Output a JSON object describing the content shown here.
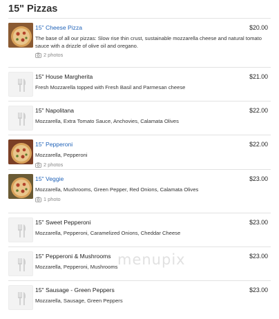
{
  "section": {
    "title": "15\" Pizzas"
  },
  "items": [
    {
      "name": "15\" Cheese Pizza",
      "link": true,
      "price": "$20.00",
      "description": "The base of all our pizzas: Slow rise thin crust, sustainable mozzarella cheese and natural tomato sauce with a drizzle of olive oil and oregano.",
      "photos": "2 photos",
      "image": "photo"
    },
    {
      "name": "15\" House Margherita",
      "link": false,
      "price": "$21.00",
      "description": "Fresh Mozzarella topped with Fresh Basil and Parmesan cheese",
      "photos": null,
      "image": "placeholder"
    },
    {
      "name": "15\" Napolitana",
      "link": false,
      "price": "$22.00",
      "description": "Mozzarella, Extra Tomato Sauce, Anchovies, Calamata Olives",
      "photos": null,
      "image": "placeholder"
    },
    {
      "name": "15\" Pepperoni",
      "link": true,
      "price": "$22.00",
      "description": "Mozzarella, Pepperoni",
      "photos": "2 photos",
      "image": "photo"
    },
    {
      "name": "15\" Veggie",
      "link": true,
      "price": "$23.00",
      "description": "Mozzarella, Mushrooms, Green Pepper, Red Onions, Calamata Olives",
      "photos": "1 photo",
      "image": "photo"
    },
    {
      "name": "15\" Sweet Pepperoni",
      "link": false,
      "price": "$23.00",
      "description": "Mozzarella, Pepperoni, Caramelized Onions, Cheddar Cheese",
      "photos": null,
      "image": "placeholder"
    },
    {
      "name": "15\" Pepperoni & Mushrooms",
      "link": false,
      "price": "$23.00",
      "description": "Mozzarella, Pepperoni, Mushrooms",
      "photos": null,
      "image": "placeholder"
    },
    {
      "name": "15\" Sausage - Green Peppers",
      "link": false,
      "price": "$23.00",
      "description": "Mozzarella, Sausage, Green Peppers",
      "photos": null,
      "image": "placeholder"
    }
  ],
  "watermark": "menupix",
  "icons": {
    "placeholder": "fork-knife-icon",
    "photos": "camera-icon"
  },
  "colors": {
    "link": "#1f62b8",
    "divider": "#e2e2e2"
  }
}
